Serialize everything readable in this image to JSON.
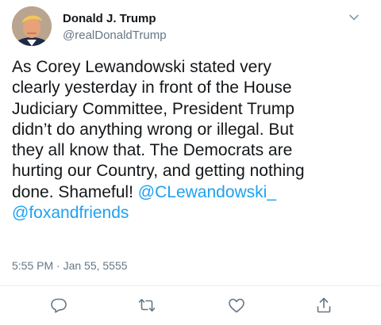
{
  "author": {
    "display_name": "Donald J. Trump",
    "handle": "@realDonaldTrump",
    "avatar_icon": "profile-photo"
  },
  "tweet": {
    "lines": [
      "As Corey Lewandowski stated very",
      "clearly yesterday in front of the House",
      "Judiciary Committee, President Trump",
      "didn’t do anything wrong or illegal. But",
      "they all know that. The Democrats are",
      "hurting our Country, and getting nothing",
      "done. Shameful! "
    ],
    "mentions": [
      "@CLewandowski_",
      "@foxandfriends"
    ],
    "timestamp": "5:55 PM · Jan 55, 5555"
  },
  "actions": {
    "reply_icon": "reply-icon",
    "retweet_icon": "retweet-icon",
    "like_icon": "heart-icon",
    "share_icon": "share-icon"
  },
  "colors": {
    "link": "#1da1f2",
    "secondary_text": "#657786",
    "icon": "#657786",
    "divider": "#e6ecf0"
  }
}
